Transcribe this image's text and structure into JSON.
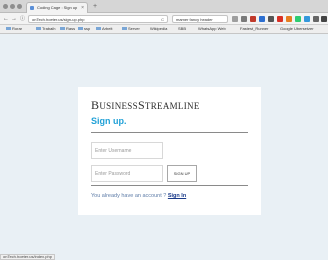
{
  "browser": {
    "tab_title": "Coding Cage : Sign up",
    "tab_close": "×",
    "new_tab": "+",
    "url": "onTech.hoeter.us/sign-up.php",
    "reload": "C",
    "search": "mamer fancy header",
    "nav": {
      "back": "←",
      "forward": "→",
      "info": "ⓘ"
    },
    "bookmarks": [
      {
        "label": "Rorar",
        "folder": true
      },
      {
        "label": "Trabaih",
        "folder": true
      },
      {
        "label": "Rass",
        "folder": true
      },
      {
        "label": "ssp",
        "folder": true
      },
      {
        "label": "Arbeit",
        "folder": true
      },
      {
        "label": "Server",
        "folder": true
      },
      {
        "label": "Wikipedia",
        "folder": false
      },
      {
        "label": "SBB",
        "folder": false
      },
      {
        "label": "WhatsApp Web",
        "folder": false
      },
      {
        "label": "Fastest_Runner",
        "folder": false
      },
      {
        "label": "Google Ubersetzer",
        "folder": false
      }
    ],
    "status_url": "onTech.hoeter.us/index.php"
  },
  "page": {
    "brand": "BusinessStreamline",
    "brand_big_1": "B",
    "brand_small_1": "USINESS",
    "brand_big_2": "S",
    "brand_small_2": "TREAMLINE",
    "title": "Sign up.",
    "username_placeholder": "Enter Username",
    "password_placeholder": "Enter Password",
    "signup_button": "SIGN UP",
    "account_text": "You already have an account ?",
    "signin_link": "Sign In"
  },
  "colors": {
    "page_bg": "#e9f0f5",
    "title": "#21a1d7",
    "link": "#1a3a8a"
  }
}
